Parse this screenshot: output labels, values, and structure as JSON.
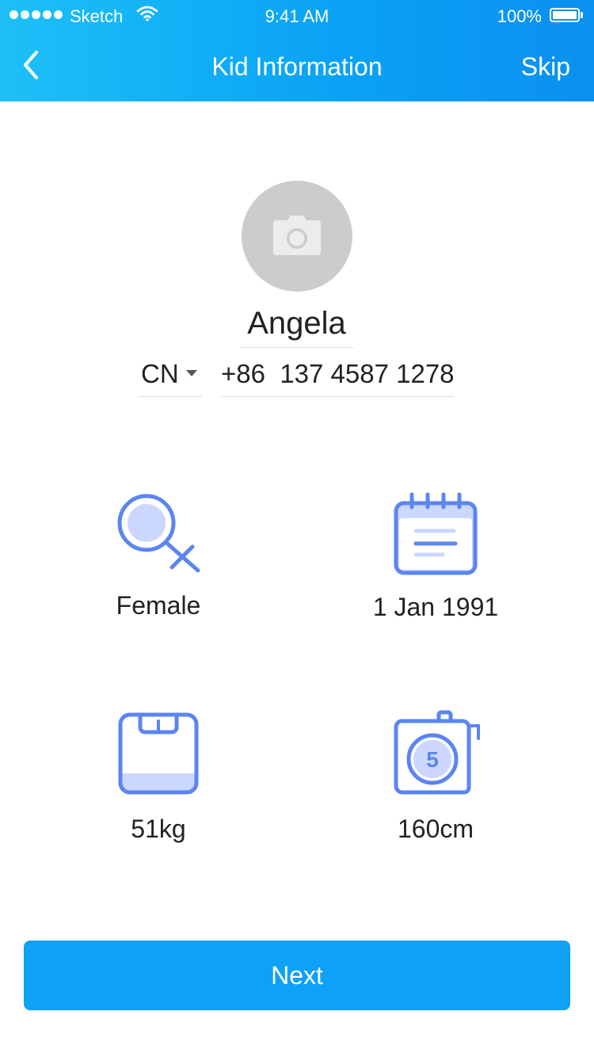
{
  "status_bar": {
    "carrier": "Sketch",
    "time": "9:41 AM",
    "battery": "100%"
  },
  "nav": {
    "title": "Kid Information",
    "skip_label": "Skip"
  },
  "profile": {
    "name": "Angela",
    "country_code": "CN",
    "phone": "+86  137 4587 1278"
  },
  "attributes": {
    "gender": "Female",
    "birthday": "1 Jan 1991",
    "weight": "51kg",
    "height": "160cm",
    "tape_digit": "5"
  },
  "next_label": "Next",
  "colors": {
    "header_gradient_start": "#1ec0f7",
    "header_gradient_end": "#0b8ff0",
    "icon_stroke": "#5b85f0",
    "icon_fill": "#cbd7ff",
    "button": "#0ea1f6",
    "avatar_bg": "#cccccc"
  },
  "icons": [
    "back-chevron-icon",
    "camera-icon",
    "female-icon",
    "calendar-icon",
    "scale-icon",
    "tape-measure-icon",
    "wifi-icon",
    "battery-icon",
    "caret-down-icon"
  ]
}
